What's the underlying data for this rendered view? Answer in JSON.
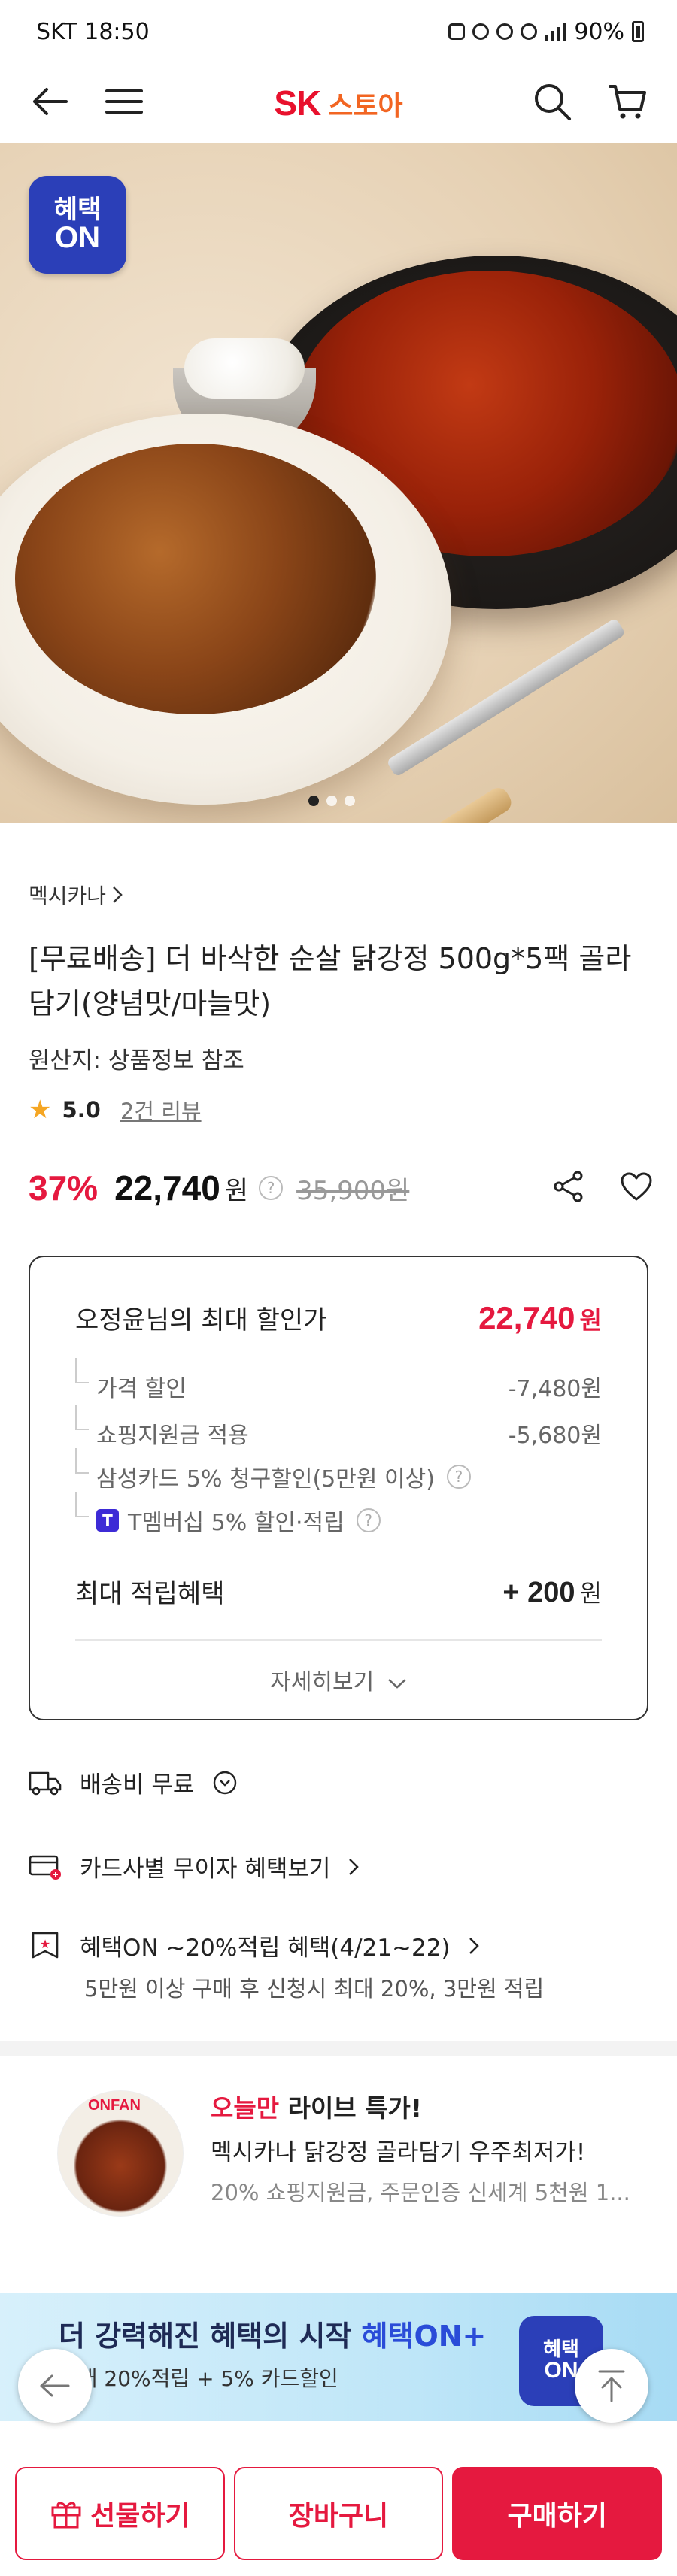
{
  "status_bar": {
    "carrier_time": "SKT 18:50",
    "battery": "90%"
  },
  "header": {
    "logo_sk": "SK",
    "logo_store": "스토아"
  },
  "hero": {
    "badge_line1": "혜택",
    "badge_line2": "ON",
    "pager": {
      "count": 3,
      "active": 1
    }
  },
  "product": {
    "brand": "멕시카나",
    "title": "[무료배송] 더 바삭한 순살 닭강정 500g*5팩 골라담기(양념맛/마늘맛)",
    "origin": "원산지: 상품정보 참조",
    "rating": "5.0",
    "review_count": "2건 리뷰",
    "discount": "37%",
    "price": "22,740",
    "won": "원",
    "original_price": "35,900원"
  },
  "discount_box": {
    "title": "오정윤님의 최대 할인가",
    "max_price": "22,740",
    "won": "원",
    "lines": [
      {
        "label": "가격 할인",
        "value": "-7,480원"
      },
      {
        "label": "쇼핑지원금 적용",
        "value": "-5,680원"
      },
      {
        "label": "삼성카드 5% 청구할인(5만원 이상)",
        "value": ""
      },
      {
        "label": "T멤버십 5% 할인·적립",
        "value": ""
      }
    ],
    "tmember_icon": "T",
    "points_label": "최대 적립혜택",
    "points_value": "+ 200",
    "points_won": "원",
    "more_label": "자세히보기"
  },
  "info_rows": {
    "shipping": "배송비 무료",
    "card": "카드사별 무이자 혜택보기",
    "benefit_on": "혜택ON ~20%적립 혜택(4/21~22)",
    "benefit_on_sub": "5만원 이상 구매 후 신청시 최대 20%, 3만원 적립"
  },
  "live": {
    "thumb_label": "ONFAN",
    "title_hl": "오늘만",
    "title_rest": " 라이브 특가!",
    "desc1": "멕시카나 닭강정 골라담기 우주최저가!",
    "desc2": "20% 쇼핑지원금, 주문인증 신세계 5천원 1..."
  },
  "promo": {
    "title_prefix": "더 강력해진 혜택의 시작 ",
    "title_hl": "혜택ON+",
    "sub": "최대 20%적립 + 5% 카드할인",
    "badge_line1": "혜택",
    "badge_line2": "ON"
  },
  "bottom": {
    "gift": "선물하기",
    "cart": "장바구니",
    "buy": "구매하기"
  },
  "colors": {
    "brand_red": "#e5193f",
    "logo_orange": "#f26522",
    "badge_blue": "#2b3fb8"
  },
  "icons": [
    "back-arrow-icon",
    "menu-icon",
    "search-icon",
    "cart-icon",
    "share-icon",
    "heart-icon",
    "truck-icon",
    "card-icon",
    "benefit-flag-icon",
    "gift-icon",
    "scroll-top-icon"
  ]
}
